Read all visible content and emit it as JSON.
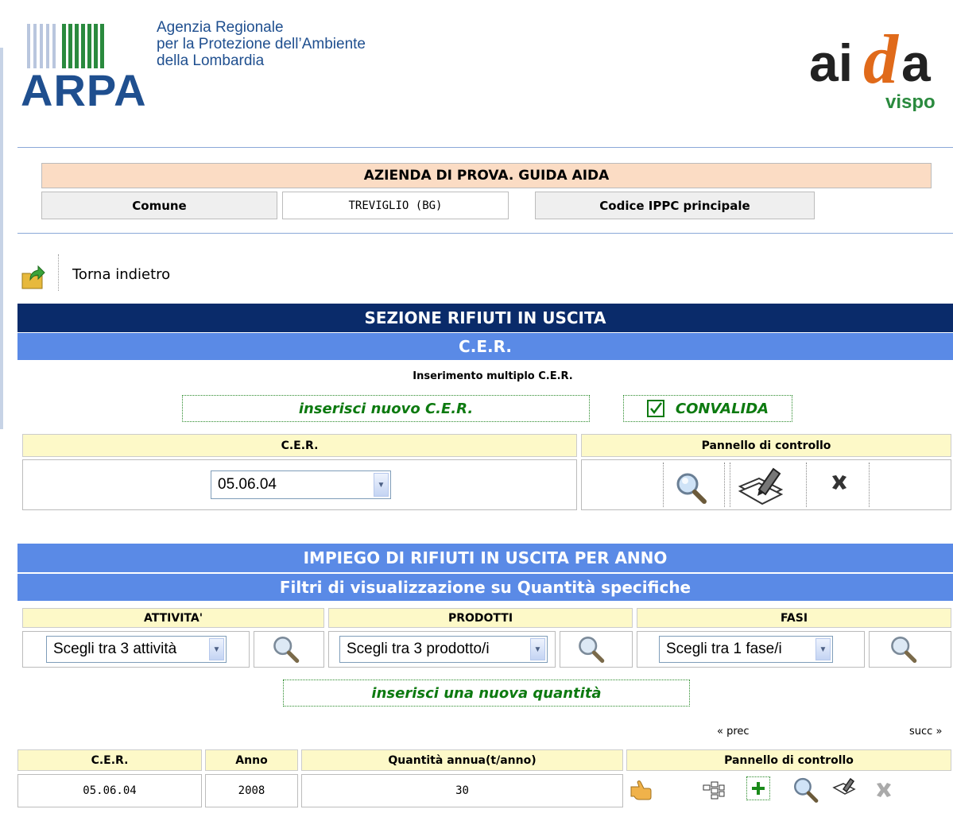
{
  "header": {
    "agency_line1": "Agenzia Regionale",
    "agency_line2": "per la Protezione dell’Ambiente",
    "agency_line3": "della Lombardia",
    "arpa_logo_text": "ARPA",
    "aida_logo_text_left": "ai",
    "aida_logo_text_d": "d",
    "aida_logo_text_right": "a",
    "aida_logo_sub": "vispo"
  },
  "company": {
    "name": "AZIENDA DI PROVA. GUIDA AIDA",
    "comune_label": "Comune",
    "comune_value": "TREVIGLIO (BG)",
    "ippc_label": "Codice IPPC principale"
  },
  "nav": {
    "back_label": "Torna indietro"
  },
  "section": {
    "title": "SEZIONE RIFIUTI IN USCITA",
    "subtitle": "C.E.R.",
    "multi_insert": "Inserimento multiplo C.E.R.",
    "insert_new_cer": "inserisci nuovo C.E.R.",
    "convalida": "CONVALIDA",
    "cer_header": "C.E.R.",
    "panel_header": "Pannello di controllo",
    "cer_selected": "05.06.04"
  },
  "impiego": {
    "title": "IMPIEGO DI RIFIUTI IN USCITA PER ANNO",
    "filters_title": "Filtri di visualizzazione su Quantità specifiche",
    "filters": [
      {
        "header": "ATTIVITA'",
        "selected": "Scegli tra 3 attività"
      },
      {
        "header": "PRODOTTI",
        "selected": "Scegli tra 3 prodotto/i"
      },
      {
        "header": "FASI",
        "selected": "Scegli tra 1 fase/i"
      }
    ],
    "insert_quantity": "inserisci una nuova quantità",
    "prev": "« prec",
    "next": "succ »",
    "table_headers": [
      "C.E.R.",
      "Anno",
      "Quantità annua(t/anno)",
      "Pannello di controllo"
    ],
    "rows": [
      {
        "cer": "05.06.04",
        "anno": "2008",
        "quantita": "30"
      }
    ]
  },
  "colors": {
    "navy_bar": "#0a2b6a",
    "blue_bar": "#5a8ae6",
    "green_text": "#0d7a10",
    "peach": "#fbdcc4",
    "yellow_header": "#fdf9c8"
  }
}
